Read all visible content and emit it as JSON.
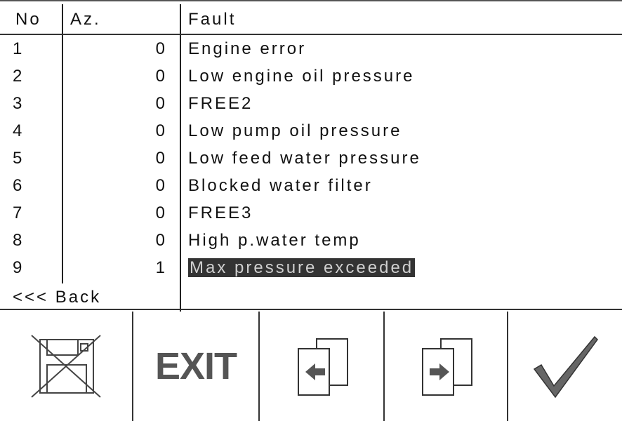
{
  "table": {
    "headers": {
      "no": "No",
      "az": "Az.",
      "fault": "Fault"
    },
    "rows": [
      {
        "no": "1",
        "count": "0",
        "fault": "Engine error"
      },
      {
        "no": "2",
        "count": "0",
        "fault": "Low engine oil pressure"
      },
      {
        "no": "3",
        "count": "0",
        "fault": "FREE2"
      },
      {
        "no": "4",
        "count": "0",
        "fault": "Low pump oil pressure"
      },
      {
        "no": "5",
        "count": "0",
        "fault": "Low feed water pressure"
      },
      {
        "no": "6",
        "count": "0",
        "fault": "Blocked water filter"
      },
      {
        "no": "7",
        "count": "0",
        "fault": "FREE3"
      },
      {
        "no": "8",
        "count": "0",
        "fault": "High p.water temp"
      },
      {
        "no": "9",
        "count": "1",
        "fault": "Max pressure exceeded"
      }
    ],
    "selected_row": 9,
    "back_label": "<<< Back"
  },
  "toolbar": {
    "exit_label": "EXIT",
    "icons": [
      "delete-save-icon",
      "exit-icon",
      "previous-page-icon",
      "next-page-icon",
      "checkmark-icon"
    ]
  },
  "colors": {
    "highlight_bg": "#333333",
    "highlight_text": "#cfcfcf",
    "lines": "#222222"
  }
}
